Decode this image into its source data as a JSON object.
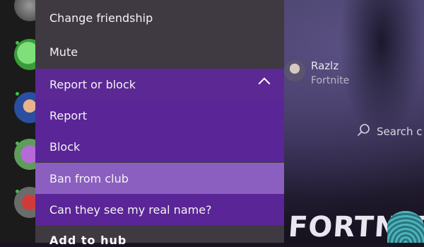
{
  "menu": {
    "items": [
      {
        "label": "Change friendship"
      },
      {
        "label": "Mute"
      },
      {
        "label": "Report or block"
      },
      {
        "label": "Report"
      },
      {
        "label": "Block"
      },
      {
        "label": "Ban from club"
      },
      {
        "label": "Can they see my real name?"
      },
      {
        "label": "Add to hub"
      }
    ]
  },
  "profile": {
    "name": "Razlz",
    "game": "Fortnite"
  },
  "search": {
    "label": "Search c"
  },
  "game_logo": {
    "text": "FORTNITE"
  },
  "colors": {
    "menu_bg": "#3f3a41",
    "submenu_bg": "#5a2596",
    "highlight_bg": "#8b5fbf",
    "online_dot": "#43c248"
  }
}
